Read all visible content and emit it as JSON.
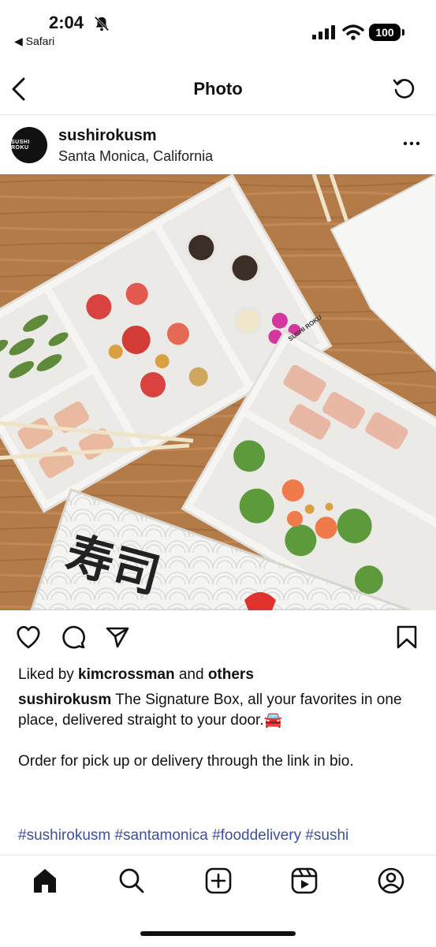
{
  "status_bar": {
    "time": "2:04",
    "back_app": "◀ Safari",
    "battery": "100"
  },
  "header": {
    "title": "Photo"
  },
  "post": {
    "username": "sushirokusm",
    "location": "Santa Monica, California",
    "avatar_text": "SUSHI ROKU",
    "likes_prefix": "Liked by ",
    "liked_by": "kimcrossman",
    "likes_and": " and ",
    "likes_others": "others",
    "caption_user": "sushirokusm",
    "caption_text": " The Signature Box, all your favorites in one place, delivered straight to your door.🚘",
    "caption_text2": "Order for pick up or delivery through the link in bio.",
    "hashtags": "#sushirokusm #santamonica #fooddelivery #sushi",
    "photo_box_text": "SUSHI ROKU"
  },
  "colors": {
    "hashtag": "#3d4fa0",
    "brand_red": "#e0322f",
    "wood": "#b07a45"
  },
  "icons": {
    "tabs": [
      "home-icon",
      "search-icon",
      "create-icon",
      "reels-icon",
      "profile-icon"
    ],
    "actions": [
      "heart-icon",
      "comment-icon",
      "share-icon",
      "bookmark-icon"
    ]
  }
}
